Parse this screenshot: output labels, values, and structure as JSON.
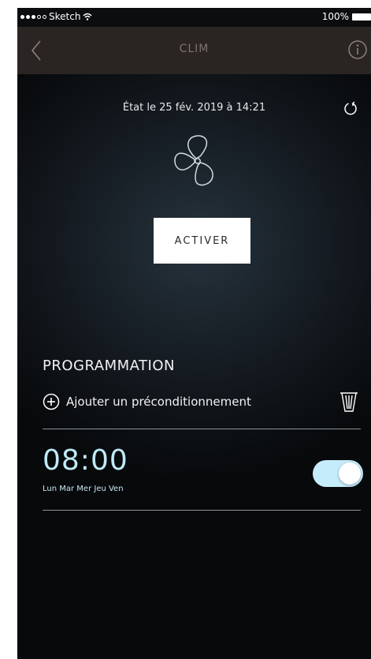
{
  "statusbar": {
    "carrier": "Sketch",
    "battery": "100%",
    "signal_bars_filled": 3,
    "signal_bars_total": 5
  },
  "nav": {
    "title": "CLIM"
  },
  "status": {
    "text": "État le 25 fév. 2019 à 14:21"
  },
  "actions": {
    "activate_label": "ACTIVER"
  },
  "programming": {
    "title": "PROGRAMMATION",
    "add_label": "Ajouter un préconditionnement",
    "schedule": {
      "time": "08:00",
      "days": "Lun Mar Mer Jeu Ven",
      "enabled": true
    }
  },
  "colors": {
    "accent": "#c5ecfb",
    "time_text": "#bfe9f7",
    "navbar": "#2a2523",
    "nav_title": "#7b726d"
  },
  "icons": [
    "chevron-left-icon",
    "info-icon",
    "refresh-icon",
    "fan-icon",
    "plus-circle-icon",
    "trash-icon",
    "wifi-icon"
  ]
}
